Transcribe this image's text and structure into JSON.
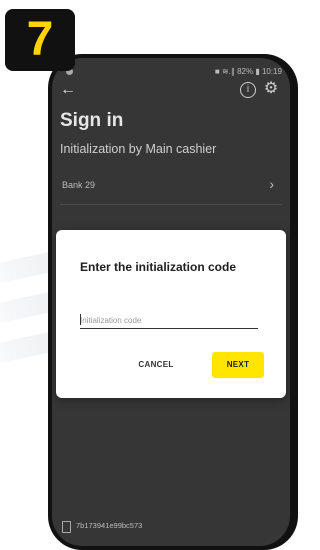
{
  "step": {
    "number": "7"
  },
  "status_bar": {
    "right_text": "■ ≋.∥ 82% ▮ 10:19"
  },
  "toolbar": {
    "back_glyph": "←",
    "info_glyph": "i",
    "settings_glyph": "⚙"
  },
  "screen": {
    "title": "Sign in",
    "subtitle": "Initialization by Main cashier",
    "bank_label": "Bank 29",
    "bank_chevron": "›",
    "device_id": "7b173941e99bc573"
  },
  "dialog": {
    "title": "Enter the initialization code",
    "placeholder": "Initialization code",
    "cancel_label": "CANCEL",
    "next_label": "NEXT"
  },
  "colors": {
    "accent": "#ffe500",
    "badge_number": "#ffd400",
    "screen_background": "#363636"
  },
  "icons": [
    "back-arrow-icon",
    "info-icon",
    "gear-icon",
    "chevron-right-icon",
    "phone-device-icon"
  ]
}
